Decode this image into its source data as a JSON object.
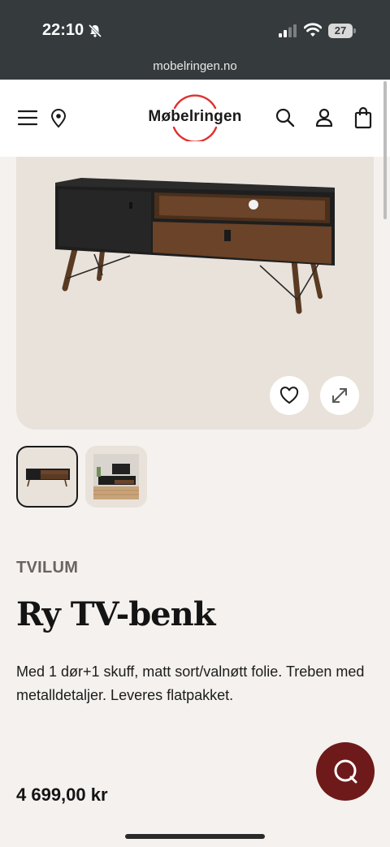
{
  "status_bar": {
    "time": "22:10",
    "battery": "27",
    "url": "mobelringen.no"
  },
  "header": {
    "logo_text": "Møbelringen",
    "icons": [
      "menu-icon",
      "location-pin-icon",
      "search-icon",
      "user-icon",
      "shopping-bag-icon"
    ],
    "logo_accent_color": "#e0312f"
  },
  "gallery": {
    "buttons": [
      "heart-icon",
      "expand-icon"
    ],
    "thumbnails": [
      "tv-bench-product-photo",
      "tv-bench-room-photo"
    ],
    "active_thumbnail": 1
  },
  "product": {
    "brand": "TVILUM",
    "title": "Ry TV-benk",
    "description": "Med 1 dør+1 skuff, matt sort/valnøtt folie. Treben med metalldetaljer. Leveres flatpakket.",
    "price": "4 699,00 kr"
  },
  "chat": {
    "icon": "chat-icon",
    "color": "#6e1a1a"
  }
}
